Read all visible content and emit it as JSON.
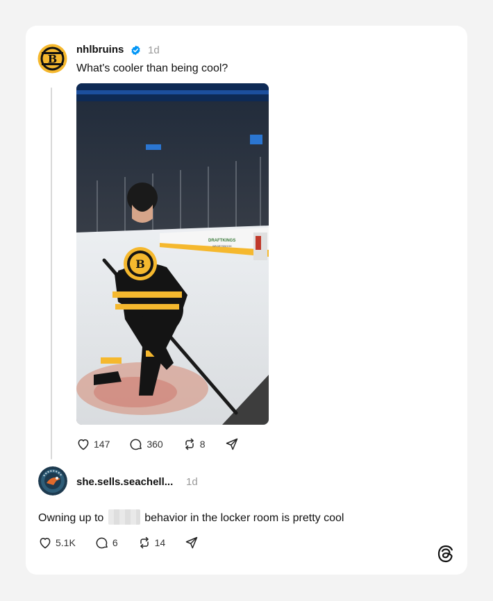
{
  "post": {
    "username": "nhlbruins",
    "verified": true,
    "time": "1d",
    "text": "What's cooler than being cool?",
    "avatar_icon": "bruins-logo",
    "likes": "147",
    "replies": "360",
    "reposts": "8"
  },
  "reply": {
    "username": "she.sells.seachell...",
    "time": "1d",
    "text_before": "Owning up to",
    "text_after": "behavior in the locker room is pretty cool",
    "avatar_icon": "team-logo-avatar",
    "likes": "5.1K",
    "replies": "6",
    "reposts": "14"
  },
  "media_ad": {
    "line1": "DRAFTKINGS",
    "line2": "SPORTSBOOK"
  },
  "colors": {
    "verified": "#0095f6",
    "bruins_gold": "#f5b82e",
    "text": "#101010",
    "muted": "#999999"
  },
  "icons": [
    "heart-icon",
    "comment-icon",
    "repost-icon",
    "share-icon",
    "threads-logo-icon",
    "verified-icon"
  ]
}
